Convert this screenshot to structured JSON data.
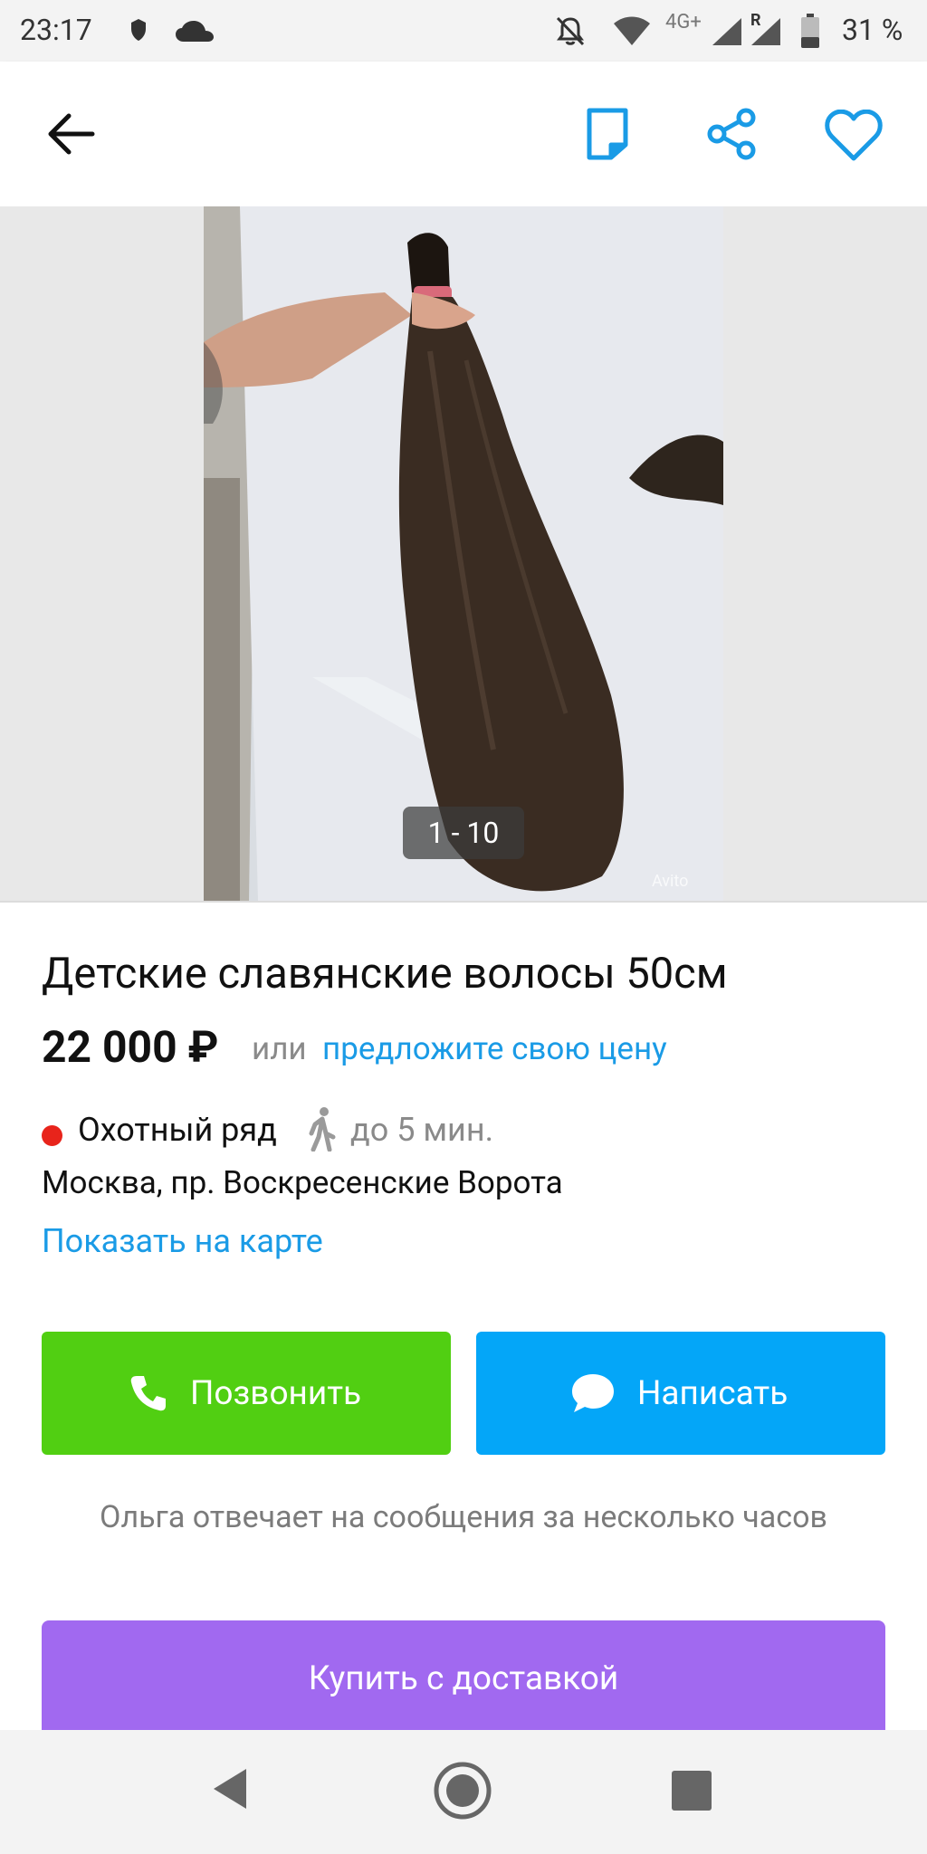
{
  "status_bar": {
    "time": "23:17",
    "network": "4G+",
    "roaming": "R",
    "battery": "31 %",
    "icons": [
      "shield-icon",
      "cloud-icon",
      "notifications-off-icon",
      "wifi-icon",
      "signal-icon",
      "signal-roaming-icon",
      "battery-icon"
    ]
  },
  "app_bar": {
    "icons": [
      "back-arrow-icon",
      "note-icon",
      "share-icon",
      "heart-icon"
    ],
    "accent": "#1a9be6"
  },
  "gallery": {
    "counter": "1 - 10",
    "watermark": "Avito",
    "background": "#e8e8e8"
  },
  "listing": {
    "title": "Детские славянские волосы 50см",
    "price": "22 000 ₽",
    "or_label": "или",
    "offer_link": "предложите свою цену",
    "metro_station": "Охотный ряд",
    "metro_color": "#e8241b",
    "walk_time": "до 5 мин.",
    "address": "Москва, пр. Воскресенские Ворота",
    "map_link": "Показать на карте"
  },
  "actions": {
    "call_label": "Позвонить",
    "call_color": "#51cf12",
    "message_label": "Написать",
    "message_color": "#04a6f8",
    "reply_note": "Ольга отвечает на сообщения за несколько часов",
    "buy_label": "Купить с доставкой",
    "buy_color": "#a169f0"
  },
  "nav_bar": {
    "icons": [
      "back-triangle-icon",
      "home-circle-icon",
      "recents-square-icon"
    ]
  }
}
